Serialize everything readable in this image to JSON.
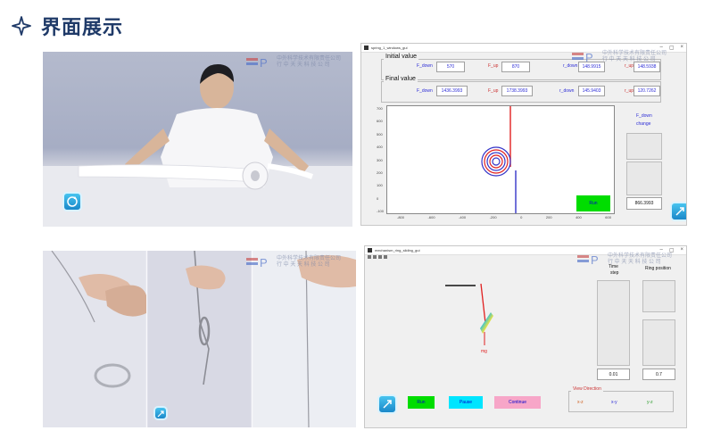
{
  "page": {
    "title": "界面展示",
    "accent": "#1f3a68"
  },
  "watermark": {
    "logo_letter": "P",
    "text_top": "中外科学技术有限责任公司",
    "text_bottom": "行 中 天 天 科 技 公 司"
  },
  "win1": {
    "title": "spring_1_windows_gui",
    "initial_label": "Initial value",
    "final_label": "Final value",
    "initial": {
      "f_down_label": "F_down",
      "f_down": "570",
      "f_up_label": "F_up",
      "f_up": "870",
      "r_down_label": "r_down",
      "r_down": "148.9915",
      "r_up_label": "r_up",
      "r_up": "148.5938"
    },
    "final": {
      "f_down_label": "F_down",
      "f_down": "1436.3993",
      "f_up_label": "F_up",
      "f_up": "1738.3993",
      "r_down_label": "r_down",
      "r_down": "145.9403",
      "r_up_label": "r_up",
      "r_up": "120.7262"
    },
    "y_ticks": [
      "700",
      "600",
      "500",
      "400",
      "300",
      "200",
      "100",
      "0",
      "-100"
    ],
    "x_ticks": [
      "-800",
      "-600",
      "-400",
      "-200",
      "0",
      "200",
      "400",
      "600"
    ],
    "side_label_1": "F_down",
    "side_label_2": "change",
    "change_value": "866.3993",
    "run_button": "Run"
  },
  "win2": {
    "title": "mechanism_ring_sliding_gui",
    "time_label_1": "Time",
    "time_label_2": "step",
    "ring_label": "Ring position",
    "time_value": "0.01",
    "ring_value": "0.7",
    "mg_label": "mg",
    "run_button": "Run",
    "pause_button": "Pause",
    "continue_button": "Continue",
    "view_direction_label": "View Direction",
    "view_options": [
      "x-z",
      "x-y",
      "y-z"
    ]
  },
  "colors": {
    "run_green": "#00dd00",
    "pause_cyan": "#00e5ff",
    "continue_pink": "#f7a6c8",
    "plot_red": "#e02020",
    "plot_blue": "#3434c8"
  }
}
